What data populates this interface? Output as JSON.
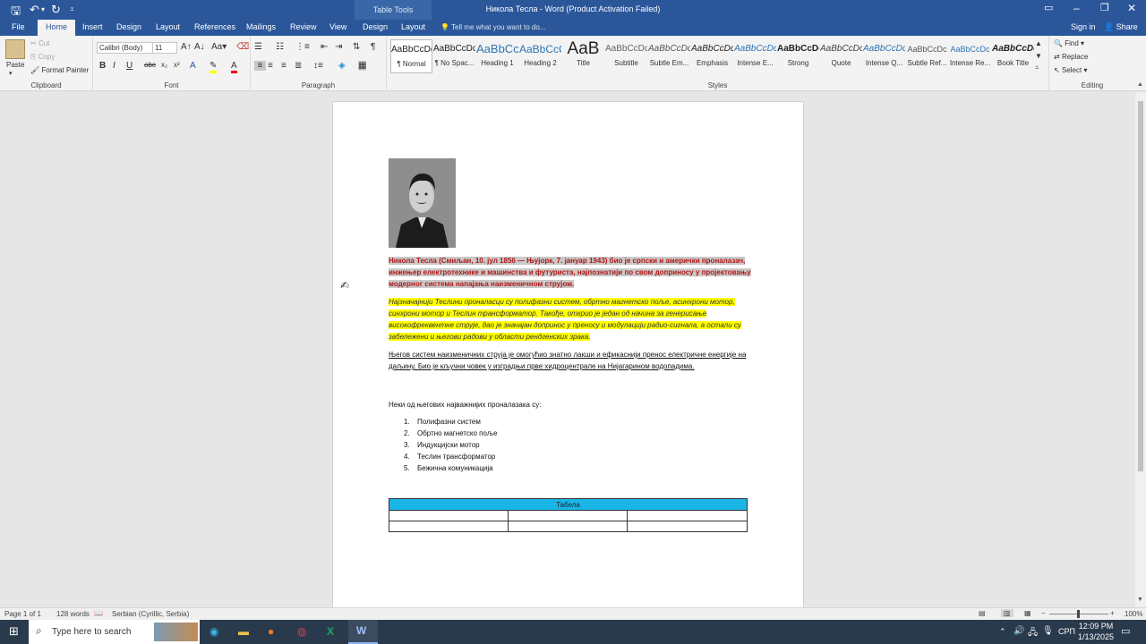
{
  "titlebar": {
    "window_title": "Никола Тесла - Word (Product Activation Failed)",
    "table_tools": "Table Tools",
    "sign_in": "Sign in",
    "share": "Share"
  },
  "tabs": [
    "File",
    "Home",
    "Insert",
    "Design",
    "Layout",
    "References",
    "Mailings",
    "Review",
    "View",
    "Design",
    "Layout"
  ],
  "tell_me": "Tell me what you want to do...",
  "ribbon": {
    "clipboard": {
      "label": "Clipboard",
      "paste": "Paste",
      "cut": "Cut",
      "copy": "Copy",
      "format_painter": "Format Painter"
    },
    "font": {
      "label": "Font",
      "name": "Calibri (Body)",
      "size": "11"
    },
    "paragraph": {
      "label": "Paragraph"
    },
    "styles": {
      "label": "Styles",
      "items": [
        {
          "preview": "AaBbCcDc",
          "name": "¶ Normal"
        },
        {
          "preview": "AaBbCcDc",
          "name": "¶ No Spac..."
        },
        {
          "preview": "AaBbCc",
          "name": "Heading 1"
        },
        {
          "preview": "AaBbCcC",
          "name": "Heading 2"
        },
        {
          "preview": "AaB",
          "name": "Title"
        },
        {
          "preview": "AaBbCcDc",
          "name": "Subtitle"
        },
        {
          "preview": "AaBbCcDc",
          "name": "Subtle Em..."
        },
        {
          "preview": "AaBbCcDc",
          "name": "Emphasis"
        },
        {
          "preview": "AaBbCcDc",
          "name": "Intense E..."
        },
        {
          "preview": "AaBbCcDc",
          "name": "Strong"
        },
        {
          "preview": "AaBbCcDc",
          "name": "Quote"
        },
        {
          "preview": "AaBbCcDc",
          "name": "Intense Q..."
        },
        {
          "preview": "AaBbCcDc",
          "name": "Subtle Ref..."
        },
        {
          "preview": "AaBbCcDc",
          "name": "Intense Re..."
        },
        {
          "preview": "AaBbCcDc",
          "name": "Book Title"
        }
      ]
    },
    "editing": {
      "label": "Editing",
      "find": "Find",
      "replace": "Replace",
      "select": "Select"
    }
  },
  "document": {
    "para1": "Никола Тесла (Смиљан, 10. јул 1856 — Њујорк, 7. јануар 1943) био је српски и амерички проналазач, инжењер електротехнике и машинства и футуриста, најпознатији по свом доприносу у пројектовању модерног система напајања наизменичном струјом.",
    "para2": "Најзначајнији Теслини проналасци су полифазни систем, обртно магнетско поље, асинхрони мотор, синхрони мотор и Теслин трансформатор. Такође, открио је један од начина за генерисање високофреквентне струје, дао је значајан допринос у преносу и модулацији радио-сигнала, а остали су забележени и његови радови у области рендгенских зрака.",
    "para3": "Његов систем наизменичних струја је омогућио знатно лакши и ефикаснији пренос електричне енергије на даљину. Био је кључни човек у изградњи прве хидроцентрале на Нијагарином водопадима.",
    "para4": "Неки од његових најважнијих проналазака су:",
    "list": [
      {
        "num": "1.",
        "text": "Полифазни систем"
      },
      {
        "num": "2.",
        "text": "Обртно магнетско поље"
      },
      {
        "num": "3.",
        "text": "Индукцијски мотор"
      },
      {
        "num": "4.",
        "text": "Теслин трансформатор"
      },
      {
        "num": "5.",
        "text": "Бежична комуникација"
      }
    ],
    "table_header": "Табела"
  },
  "statusbar": {
    "page": "Page 1 of 1",
    "words": "128 words",
    "language": "Serbian (Cyrillic, Serbia)",
    "zoom": "100%"
  },
  "taskbar": {
    "search_placeholder": "Type here to search",
    "time": "12:09 PM",
    "date": "1/13/2025",
    "lang": "СРП"
  },
  "colors": {
    "word_blue": "#2b579a",
    "highlight_yellow": "#ffff00",
    "table_header": "#1bb6e8",
    "red_text": "#b31616"
  }
}
